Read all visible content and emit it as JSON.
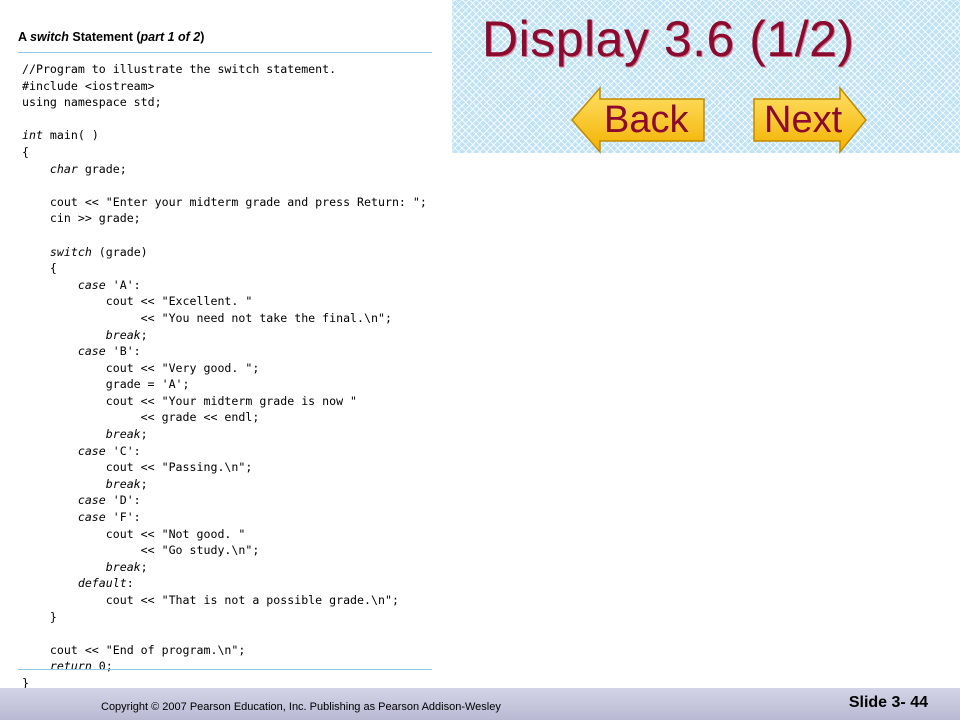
{
  "slide": {
    "title": "Display 3.6  (1/2)",
    "back_label": "Back",
    "next_label": "Next",
    "caption_prefix": "A ",
    "caption_keyword": "switch",
    "caption_suffix": " Statement (",
    "caption_part": "part 1 of 2",
    "caption_end": ")",
    "copyright": "Copyright © 2007 Pearson Education, Inc. Publishing as Pearson Addison-Wesley",
    "slide_number": "Slide 3- 44"
  },
  "code_lines": [
    {
      "pre": "//Program to illustrate the switch statement.",
      "kw": "",
      "post": ""
    },
    {
      "pre": "#include <iostream>",
      "kw": "",
      "post": ""
    },
    {
      "pre": "using namespace std;",
      "kw": "",
      "post": ""
    },
    {
      "pre": "",
      "kw": "",
      "post": ""
    },
    {
      "pre": "",
      "kw": "int",
      "post": " main( )"
    },
    {
      "pre": "{",
      "kw": "",
      "post": ""
    },
    {
      "pre": "    ",
      "kw": "char",
      "post": " grade;"
    },
    {
      "pre": "",
      "kw": "",
      "post": ""
    },
    {
      "pre": "    cout << \"Enter your midterm grade and press Return: \";",
      "kw": "",
      "post": ""
    },
    {
      "pre": "    cin >> grade;",
      "kw": "",
      "post": ""
    },
    {
      "pre": "",
      "kw": "",
      "post": ""
    },
    {
      "pre": "    ",
      "kw": "switch",
      "post": " (grade)"
    },
    {
      "pre": "    {",
      "kw": "",
      "post": ""
    },
    {
      "pre": "        ",
      "kw": "case",
      "post": " 'A':"
    },
    {
      "pre": "            cout << \"Excellent. \"",
      "kw": "",
      "post": ""
    },
    {
      "pre": "                 << \"You need not take the final.\\n\";",
      "kw": "",
      "post": ""
    },
    {
      "pre": "            ",
      "kw": "break",
      "post": ";"
    },
    {
      "pre": "        ",
      "kw": "case",
      "post": " 'B':"
    },
    {
      "pre": "            cout << \"Very good. \";",
      "kw": "",
      "post": ""
    },
    {
      "pre": "            grade = 'A';",
      "kw": "",
      "post": ""
    },
    {
      "pre": "            cout << \"Your midterm grade is now \"",
      "kw": "",
      "post": ""
    },
    {
      "pre": "                 << grade << endl;",
      "kw": "",
      "post": ""
    },
    {
      "pre": "            ",
      "kw": "break",
      "post": ";"
    },
    {
      "pre": "        ",
      "kw": "case",
      "post": " 'C':"
    },
    {
      "pre": "            cout << \"Passing.\\n\";",
      "kw": "",
      "post": ""
    },
    {
      "pre": "            ",
      "kw": "break",
      "post": ";"
    },
    {
      "pre": "        ",
      "kw": "case",
      "post": " 'D':"
    },
    {
      "pre": "        ",
      "kw": "case",
      "post": " 'F':"
    },
    {
      "pre": "            cout << \"Not good. \"",
      "kw": "",
      "post": ""
    },
    {
      "pre": "                 << \"Go study.\\n\";",
      "kw": "",
      "post": ""
    },
    {
      "pre": "            ",
      "kw": "break",
      "post": ";"
    },
    {
      "pre": "        ",
      "kw": "default",
      "post": ":"
    },
    {
      "pre": "            cout << \"That is not a possible grade.\\n\";",
      "kw": "",
      "post": ""
    },
    {
      "pre": "    }",
      "kw": "",
      "post": ""
    },
    {
      "pre": "",
      "kw": "",
      "post": ""
    },
    {
      "pre": "    cout << \"End of program.\\n\";",
      "kw": "",
      "post": ""
    },
    {
      "pre": "    ",
      "kw": "return",
      "post": " 0;"
    },
    {
      "pre": "}",
      "kw": "",
      "post": ""
    }
  ]
}
